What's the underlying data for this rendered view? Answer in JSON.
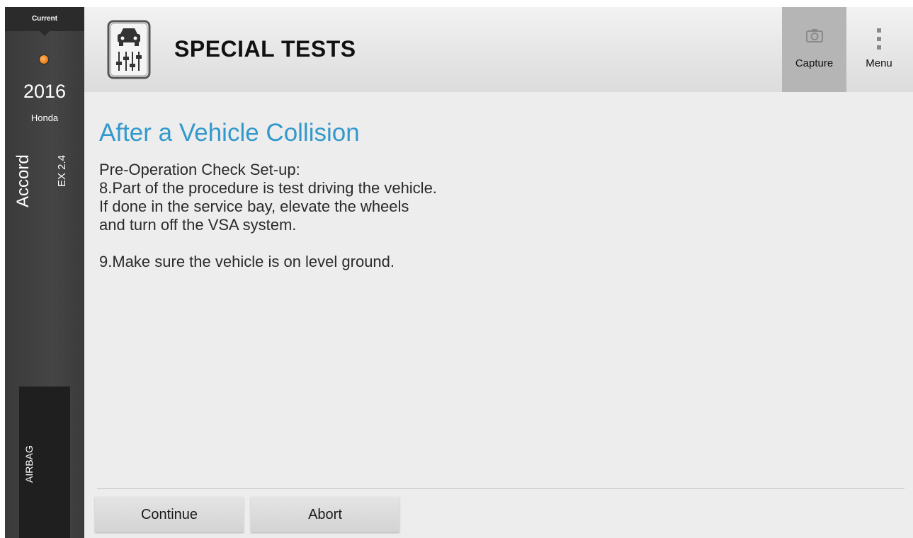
{
  "sidebar": {
    "current_label": "Current",
    "year": "2016",
    "make": "Honda",
    "model": "Accord",
    "trim": "EX 2.4",
    "system": "AIRBAG",
    "status_dot_color": "#f08a24"
  },
  "header": {
    "title": "SPECIAL TESTS",
    "icon": "car-lift-icon",
    "capture_label": "Capture",
    "capture_icon": "camera-icon",
    "menu_label": "Menu",
    "menu_icon": "vertical-dots-icon"
  },
  "main": {
    "section_title": "After a Vehicle Collision",
    "lines": [
      "Pre-Operation Check Set-up:",
      "8.Part of the procedure is test driving the vehicle.",
      "If done in the service bay, elevate the wheels",
      "and turn off the VSA system.",
      "",
      "9.Make sure the vehicle is on level ground."
    ],
    "title_color": "#3399cc"
  },
  "footer": {
    "continue_label": "Continue",
    "abort_label": "Abort"
  }
}
